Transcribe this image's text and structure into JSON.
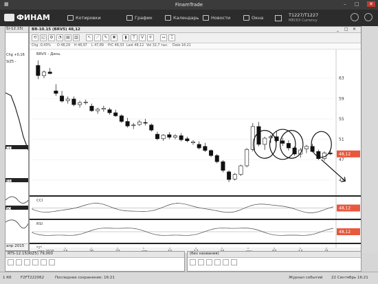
{
  "window": {
    "title": "FinamTrade"
  },
  "nav": {
    "logo": "ФИНАМ",
    "items": [
      {
        "label": "Котировки",
        "icon": "quotes-icon"
      },
      {
        "label": "График",
        "icon": "chart-icon"
      },
      {
        "label": "Календарь",
        "icon": "calendar-icon"
      },
      {
        "label": "Новости",
        "icon": "news-icon"
      },
      {
        "label": "Окна",
        "icon": "windows-icon"
      }
    ],
    "account_id": "T1227/T1227",
    "account_sub": "MECEX Currency"
  },
  "left_window": {
    "title": "Si-12.15(",
    "chg_label": "Chg +0,16",
    "ticker_label": "SiZ5 -",
    "indicators": [
      "CCI",
      "RSI",
      "SO"
    ],
    "date_label": "апр 2015"
  },
  "chart_window": {
    "title": "BR-10.15 (BRV5) 48,12",
    "toolbar": [
      "1",
      "2",
      "3",
      "4",
      "5",
      "6",
      "7",
      "8",
      "9",
      "10",
      "11",
      "12",
      "13",
      "14",
      "15",
      "16"
    ],
    "quote_bar": {
      "chg": "Chg -0,43%",
      "o": "O 48,29",
      "h": "H 48,97",
      "l": "L 47,89",
      "prc": "PrC 48,33",
      "last": "Last 48,12",
      "vol": "Vol 32,7 тыс.",
      "date": "Date 16:21"
    },
    "instrument_label": "BRV5 - День",
    "indicator_labels": [
      "CCI",
      "RSI",
      "SO"
    ]
  },
  "chart_data": {
    "type": "candlestick",
    "series_name": "BRV5 - День",
    "ylim": [
      40,
      67
    ],
    "y_ticks": [
      43,
      47,
      51,
      55,
      59,
      63
    ],
    "x_ticks": [
      "июл 2015",
      "13",
      "20",
      "27",
      "авг",
      "10",
      "17",
      "24",
      "сен",
      "07",
      "14",
      "21"
    ],
    "last_price": "48,12",
    "ohlc": [
      [
        65.5,
        66.5,
        62.8,
        63.5
      ],
      [
        63.5,
        64.5,
        63.0,
        64.2
      ],
      [
        64.2,
        65.0,
        63.8,
        63.9
      ],
      [
        60.5,
        61.8,
        59.5,
        60.0
      ],
      [
        59.5,
        60.5,
        58.2,
        58.5
      ],
      [
        58.6,
        59.4,
        58.0,
        58.9
      ],
      [
        58.9,
        59.4,
        57.5,
        57.8
      ],
      [
        57.8,
        58.6,
        57.2,
        58.2
      ],
      [
        58.2,
        58.8,
        57.8,
        58.3
      ],
      [
        57.5,
        58.0,
        56.4,
        56.6
      ],
      [
        56.6,
        57.2,
        56.0,
        56.9
      ],
      [
        56.9,
        57.6,
        56.4,
        57.1
      ],
      [
        56.8,
        57.2,
        55.8,
        56.2
      ],
      [
        56.2,
        56.8,
        55.4,
        55.6
      ],
      [
        55.6,
        55.9,
        54.2,
        54.5
      ],
      [
        54.5,
        55.2,
        53.3,
        53.6
      ],
      [
        53.7,
        54.2,
        53.0,
        53.8
      ],
      [
        53.9,
        54.8,
        53.6,
        54.4
      ],
      [
        54.3,
        55.0,
        53.7,
        54.2
      ],
      [
        53.8,
        54.1,
        52.5,
        52.8
      ],
      [
        52.0,
        52.5,
        50.8,
        51.1
      ],
      [
        51.1,
        52.0,
        50.7,
        51.8
      ],
      [
        51.9,
        52.4,
        51.0,
        51.4
      ],
      [
        51.4,
        52.0,
        51.0,
        51.7
      ],
      [
        51.7,
        52.2,
        50.6,
        50.9
      ],
      [
        51.1,
        51.5,
        50.4,
        50.7
      ],
      [
        50.3,
        50.8,
        49.9,
        50.5
      ],
      [
        50.0,
        50.6,
        49.0,
        49.3
      ],
      [
        49.6,
        50.3,
        48.5,
        48.8
      ],
      [
        48.8,
        49.0,
        47.5,
        47.8
      ],
      [
        47.8,
        48.1,
        46.3,
        46.6
      ],
      [
        46.6,
        46.9,
        44.5,
        44.9
      ],
      [
        44.6,
        44.9,
        42.6,
        43.1
      ],
      [
        43.2,
        44.4,
        42.9,
        44.1
      ],
      [
        44.1,
        46.0,
        43.8,
        45.8
      ],
      [
        45.8,
        49.3,
        45.5,
        49.0
      ],
      [
        49.0,
        54.2,
        48.6,
        53.5
      ],
      [
        53.5,
        54.4,
        49.6,
        50.0
      ],
      [
        50.0,
        51.5,
        48.9,
        51.2
      ],
      [
        51.3,
        51.9,
        50.3,
        51.5
      ],
      [
        51.5,
        52.6,
        50.4,
        50.7
      ],
      [
        50.7,
        51.3,
        49.7,
        50.2
      ],
      [
        50.2,
        50.8,
        48.8,
        49.3
      ],
      [
        49.3,
        49.6,
        47.8,
        48.1
      ],
      [
        48.1,
        49.3,
        47.4,
        48.9
      ],
      [
        49.1,
        49.9,
        48.3,
        49.6
      ],
      [
        49.6,
        50.1,
        48.4,
        48.6
      ],
      [
        48.6,
        49.0,
        46.9,
        47.2
      ],
      [
        47.2,
        48.6,
        46.8,
        48.3
      ],
      [
        48.3,
        48.97,
        47.89,
        48.12
      ]
    ],
    "panels": [
      {
        "name": "CCI",
        "value": "48,12",
        "value_color": "#e8583c"
      },
      {
        "name": "RSI",
        "value": "48,12",
        "value_color": "#e8583c"
      },
      {
        "name": "SO",
        "value": "48,12",
        "value_color": "#e8583c"
      }
    ]
  },
  "bottom": {
    "left_title": "RTS-12.15(RIZ5) 79,000",
    "right_title": "(без названия)"
  },
  "status": {
    "connection": "1 Кб",
    "account": "F2FT222062",
    "saved": "Последнее сохранение: 16:21",
    "journal": "Журнал событий",
    "datetime": "22 Сентябрь 16:21"
  }
}
